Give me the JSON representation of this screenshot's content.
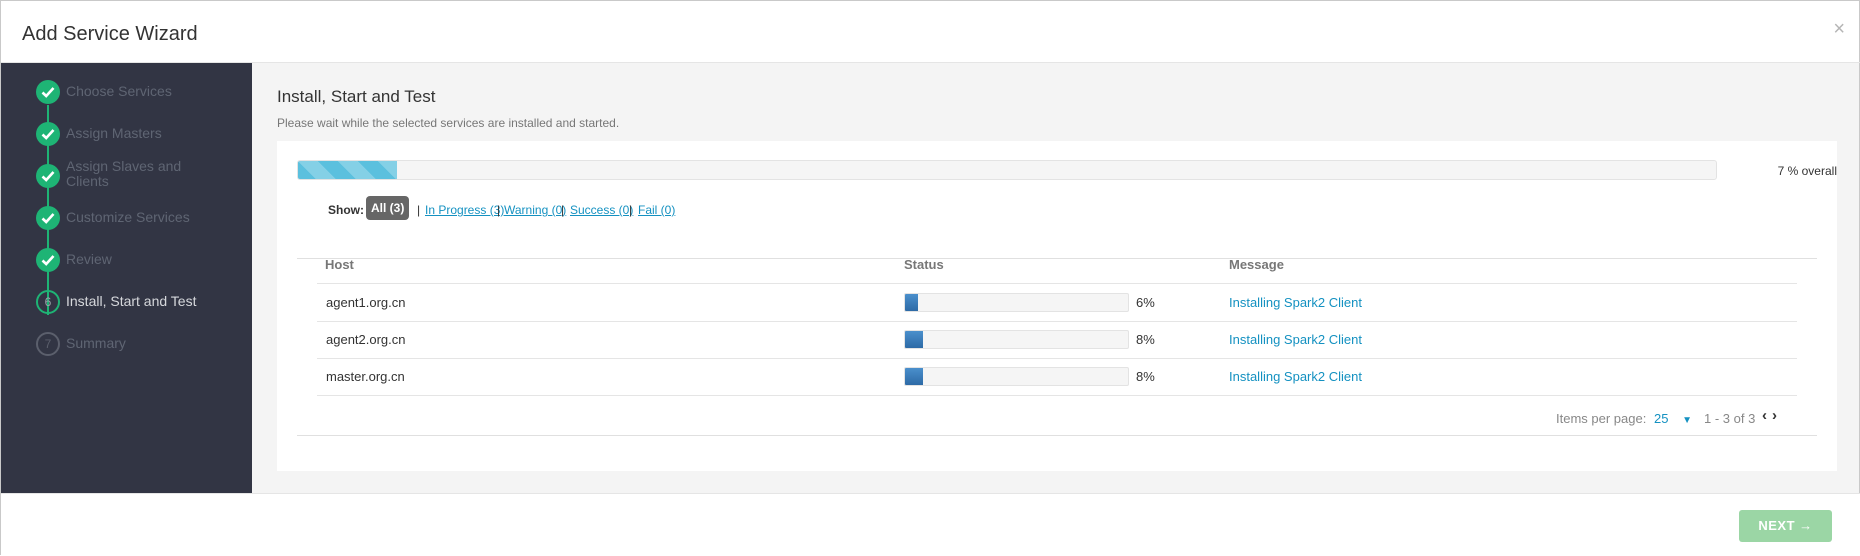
{
  "modal": {
    "title": "Add Service Wizard",
    "close_glyph": "×"
  },
  "sidebar": {
    "steps": [
      {
        "label": "Choose Services",
        "state": "done"
      },
      {
        "label": "Assign Masters",
        "state": "done"
      },
      {
        "label": "Assign Slaves and Clients",
        "state": "done"
      },
      {
        "label": "Customize Services",
        "state": "done"
      },
      {
        "label": "Review",
        "state": "done"
      },
      {
        "label": "Install, Start and Test",
        "state": "current",
        "number": "6"
      },
      {
        "label": "Summary",
        "state": "todo",
        "number": "7"
      }
    ]
  },
  "main": {
    "title": "Install, Start and Test",
    "subtitle": "Please wait while the selected services are installed and started.",
    "overall": {
      "percent": 7,
      "label": "7 % overall"
    },
    "filters": {
      "show_label": "Show:",
      "all": "All (3)",
      "in_progress": "In Progress (3)",
      "warning": "Warning (0)",
      "success": "Success (0)",
      "fail": "Fail (0)",
      "separator": "|"
    },
    "table": {
      "headers": {
        "host": "Host",
        "status": "Status",
        "message": "Message"
      },
      "rows": [
        {
          "host": "agent1.org.cn",
          "percent": 6,
          "percent_label": "6%",
          "message": "Installing Spark2 Client"
        },
        {
          "host": "agent2.org.cn",
          "percent": 8,
          "percent_label": "8%",
          "message": "Installing Spark2 Client"
        },
        {
          "host": "master.org.cn",
          "percent": 8,
          "percent_label": "8%",
          "message": "Installing Spark2 Client"
        }
      ]
    },
    "pagination": {
      "items_per_page_label": "Items per page:",
      "items_per_page_value": "25",
      "range": "1 - 3 of 3"
    }
  },
  "footer": {
    "next_label": "NEXT →"
  },
  "colors": {
    "accent_green": "#1eb475",
    "sidebar_bg": "#323544",
    "link_blue": "#1491c1",
    "progress_blue": "#5bc0de",
    "next_disabled": "#9bd6a5"
  }
}
